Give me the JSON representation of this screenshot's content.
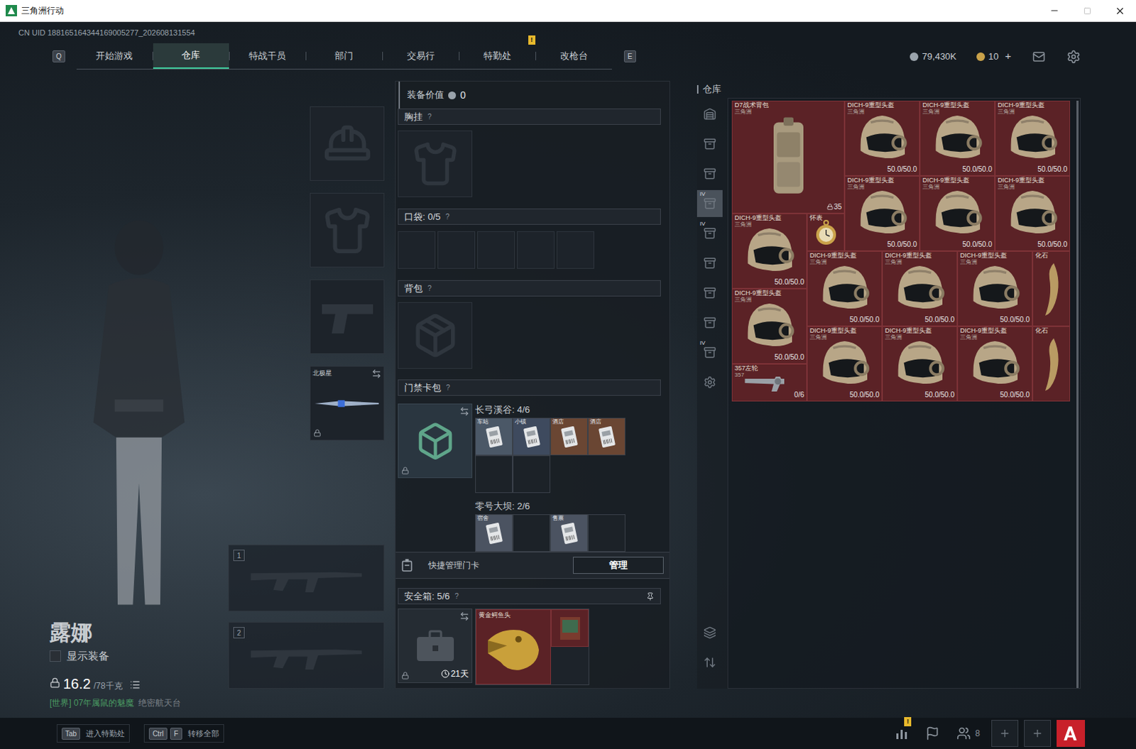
{
  "window": {
    "title": "三角洲行动"
  },
  "uid": "CN UID 188165164344169005277_202608131554",
  "nav": {
    "left_key": "Q",
    "right_key": "E",
    "tabs": [
      {
        "label": "开始游戏",
        "selected": false,
        "badge": ""
      },
      {
        "label": "仓库",
        "selected": true,
        "badge": ""
      },
      {
        "label": "特战干员",
        "selected": false,
        "badge": ""
      },
      {
        "label": "部门",
        "selected": false,
        "badge": ""
      },
      {
        "label": "交易行",
        "selected": false,
        "badge": ""
      },
      {
        "label": "特勤处",
        "selected": false,
        "badge": "!"
      },
      {
        "label": "改枪台",
        "selected": false,
        "badge": ""
      }
    ]
  },
  "currency": [
    {
      "kind": "silver",
      "amount": "79,430K",
      "add": ""
    },
    {
      "kind": "gold",
      "amount": "10",
      "add": "+"
    }
  ],
  "operator": {
    "name": "露娜",
    "show_equipment": {
      "label": "显示装备",
      "checked": false
    },
    "weight": {
      "current": "16.2",
      "max": "/78千克"
    },
    "chat": {
      "channel": "[世界]",
      "sender": "07年属鼠的魅魔",
      "message": "绝密航天台"
    }
  },
  "gear_slots": [
    {
      "kind": "helmet",
      "label": "",
      "locked": false,
      "swap": false
    },
    {
      "kind": "armor",
      "label": "",
      "locked": false,
      "swap": false
    },
    {
      "kind": "pistol",
      "label": "",
      "locked": false,
      "swap": false
    },
    {
      "kind": "melee",
      "label": "北极星",
      "locked": true,
      "swap": true
    }
  ],
  "weapon_slots": [
    {
      "number": "1"
    },
    {
      "number": "2"
    }
  ],
  "loadout": {
    "value_label": "装备价值",
    "value": "0",
    "help": "?",
    "chest": {
      "label": "胸挂"
    },
    "pocket": {
      "label": "口袋:",
      "count": "0/5",
      "slots": [
        {
          "filled": false
        },
        {
          "filled": false
        },
        {
          "filled": false
        },
        {
          "filled": false
        },
        {
          "filled": false
        }
      ]
    },
    "backpack": {
      "label": "背包"
    },
    "keycards": {
      "label": "门禁卡包",
      "locked": true,
      "maps": [
        {
          "name": "长弓溪谷: 4/6",
          "cards": [
            {
              "label": "车站",
              "filled": true,
              "color": "#4b5867"
            },
            {
              "label": "小镇",
              "filled": true,
              "color": "#3e4a5e"
            },
            {
              "label": "酒店",
              "filled": true,
              "color": "#6a4633"
            },
            {
              "label": "酒店",
              "filled": true,
              "color": "#6a4633"
            },
            {
              "label": "",
              "filled": false,
              "color": "#1c2228"
            },
            {
              "label": "",
              "filled": false,
              "color": "#1c2228"
            }
          ]
        },
        {
          "name": "零号大坝: 2/6",
          "cards": [
            {
              "label": "宿舍",
              "filled": true,
              "color": "#4b5361"
            },
            {
              "label": "",
              "filled": false,
              "color": "#1c2228"
            },
            {
              "label": "售票",
              "filled": true,
              "color": "#4b5361"
            },
            {
              "label": "",
              "filled": false,
              "color": "#1c2228"
            }
          ]
        }
      ]
    },
    "quick_manage": {
      "label": "快捷管理门卡",
      "button": "管理"
    },
    "safe_box": {
      "label": "安全箱:",
      "count": "5/6",
      "timer": "21天",
      "locked": true,
      "items": [
        {
          "name": "黄金鳄鱼头",
          "kind": "gold-head"
        },
        {
          "name": "",
          "kind": "card"
        }
      ]
    }
  },
  "warehouse": {
    "title": "仓库",
    "sidebar_top": [
      {
        "kind": "home",
        "selected": false,
        "badge": ""
      },
      {
        "kind": "rack",
        "selected": false,
        "badge": ""
      },
      {
        "kind": "rack",
        "selected": false,
        "badge": ""
      },
      {
        "kind": "rack",
        "selected": true,
        "badge": "IV"
      },
      {
        "kind": "rack",
        "selected": false,
        "badge": "IV"
      },
      {
        "kind": "rack",
        "selected": false,
        "badge": ""
      },
      {
        "kind": "rack",
        "selected": false,
        "badge": ""
      },
      {
        "kind": "rack",
        "selected": false,
        "badge": ""
      },
      {
        "kind": "rack",
        "selected": false,
        "badge": "IV"
      },
      {
        "kind": "settings",
        "selected": false,
        "badge": ""
      }
    ],
    "sidebar_bottom": [
      {
        "kind": "layers",
        "selected": false,
        "badge": ""
      },
      {
        "kind": "sort",
        "selected": false,
        "badge": ""
      }
    ],
    "items": [
      {
        "kind": "backpack",
        "name": "D7战术背包",
        "sub": "三角洲",
        "info": "35"
      },
      {
        "kind": "helmet",
        "name": "DICH-9重型头盔",
        "sub": "三角洲",
        "info": "50.0/50.0"
      },
      {
        "kind": "helmet",
        "name": "DICH-9重型头盔",
        "sub": "三角洲",
        "info": "50.0/50.0"
      },
      {
        "kind": "helmet",
        "name": "DICH-9重型头盔",
        "sub": "三角洲",
        "info": "50.0/50.0"
      },
      {
        "kind": "helmet",
        "name": "DICH-9重型头盔",
        "sub": "三角洲",
        "info": "50.0/50.0"
      },
      {
        "kind": "helmet",
        "name": "DICH-9重型头盔",
        "sub": "三角洲",
        "info": "50.0/50.0"
      },
      {
        "kind": "helmet",
        "name": "DICH-9重型头盔",
        "sub": "三角洲",
        "info": "50.0/50.0"
      },
      {
        "kind": "helmet",
        "name": "DICH-9重型头盔",
        "sub": "三角洲",
        "info": "50.0/50.0"
      },
      {
        "kind": "watch",
        "name": "怀表",
        "sub": "",
        "info": ""
      },
      {
        "kind": "helmet",
        "name": "DICH-9重型头盔",
        "sub": "三角洲",
        "info": "50.0/50.0"
      },
      {
        "kind": "helmet",
        "name": "DICH-9重型头盔",
        "sub": "三角洲",
        "info": "50.0/50.0"
      },
      {
        "kind": "helmet",
        "name": "DICH-9重型头盔",
        "sub": "三角洲",
        "info": "50.0/50.0"
      },
      {
        "kind": "fossil",
        "name": "化石",
        "sub": "",
        "info": ""
      },
      {
        "kind": "helmet",
        "name": "DICH-9重型头盔",
        "sub": "三角洲",
        "info": "50.0/50.0"
      },
      {
        "kind": "helmet",
        "name": "DICH-9重型头盔",
        "sub": "三角洲",
        "info": "50.0/50.0"
      },
      {
        "kind": "helmet",
        "name": "DICH-9重型头盔",
        "sub": "三角洲",
        "info": "50.0/50.0"
      },
      {
        "kind": "helmet",
        "name": "DICH-9重型头盔",
        "sub": "三角洲",
        "info": "50.0/50.0"
      },
      {
        "kind": "fossil",
        "name": "化石",
        "sub": "",
        "info": ""
      },
      {
        "kind": "revolver",
        "name": "357左轮",
        "sub": "357",
        "info": "0/6"
      }
    ]
  },
  "bottom_bar": {
    "shortcuts": [
      {
        "keys": [
          "Tab"
        ],
        "label": "进入特勤处"
      },
      {
        "keys": [
          "Ctrl",
          "F"
        ],
        "label": "转移全部"
      }
    ],
    "buttons": [
      {
        "kind": "stats",
        "badge": "!"
      },
      {
        "kind": "flag",
        "badge": ""
      },
      {
        "kind": "team",
        "badge": "8"
      },
      {
        "kind": "add",
        "badge": ""
      },
      {
        "kind": "add",
        "badge": ""
      },
      {
        "kind": "logo",
        "badge": ""
      }
    ]
  }
}
